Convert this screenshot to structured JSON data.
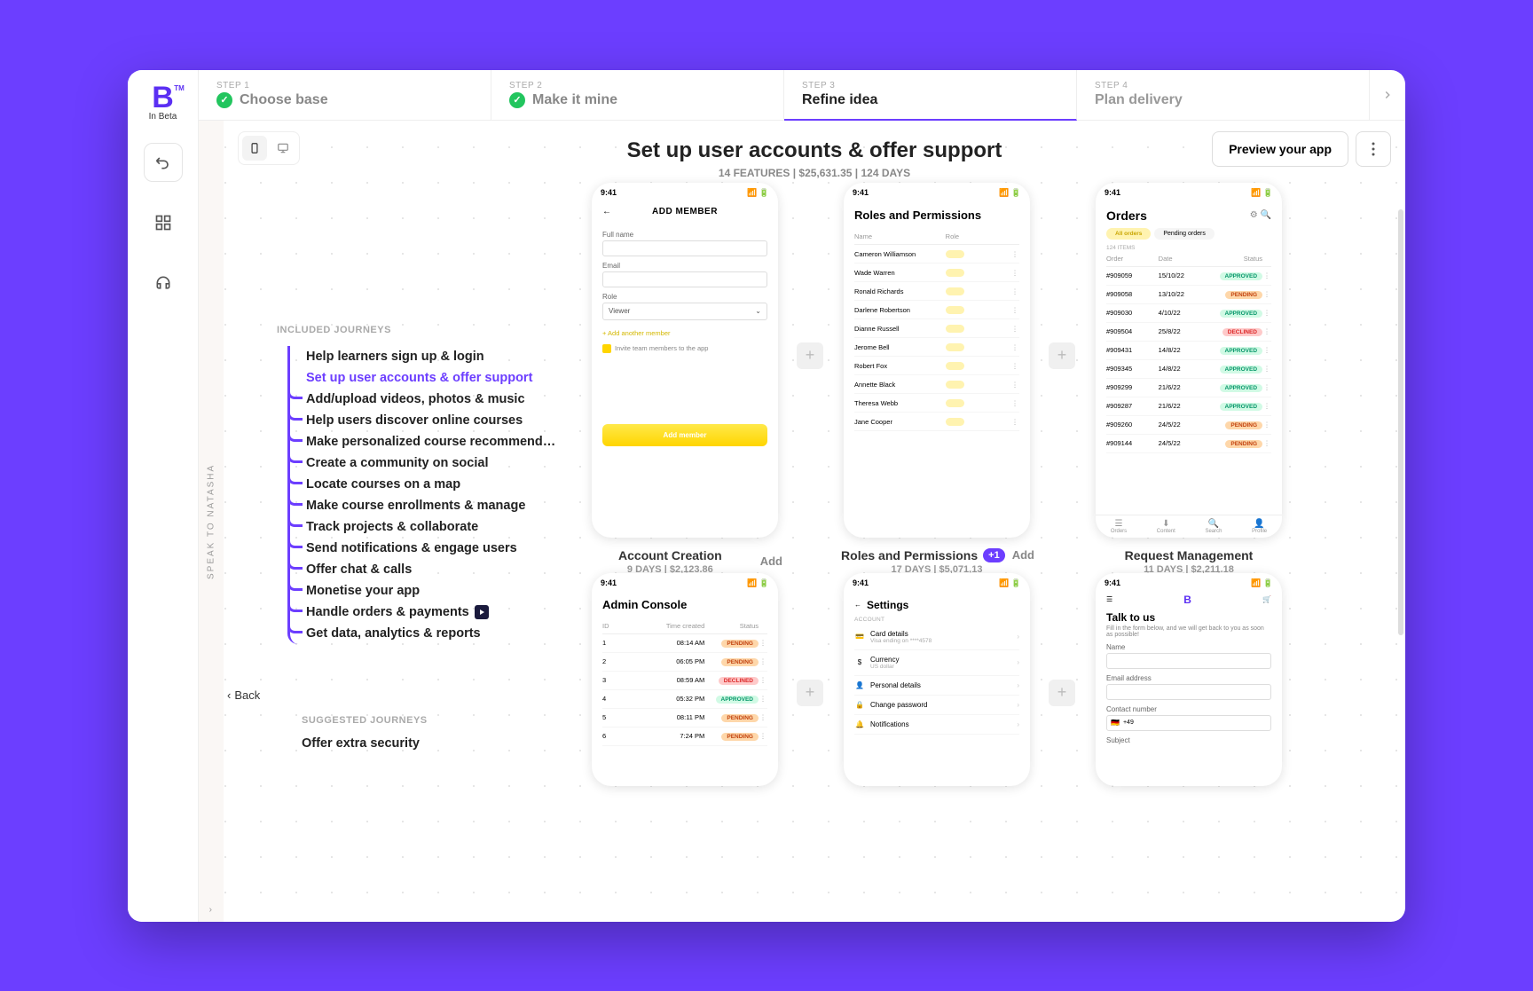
{
  "brand": {
    "logo": "B",
    "tm": "TM",
    "sub": "In Beta"
  },
  "steps": [
    {
      "num": "STEP 1",
      "title": "Choose base",
      "done": true
    },
    {
      "num": "STEP 2",
      "title": "Make it mine",
      "done": true
    },
    {
      "num": "STEP 3",
      "title": "Refine idea",
      "active": true
    },
    {
      "num": "STEP 4",
      "title": "Plan delivery"
    }
  ],
  "header": {
    "title": "Set up user accounts & offer support",
    "features": "14 FEATURES",
    "price": "$25,631.35",
    "days": "124 DAYS"
  },
  "actions": {
    "preview": "Preview your app"
  },
  "speak_label": "SPEAK TO NATASHA",
  "back_label": "Back",
  "journeys": {
    "included_heading": "INCLUDED JOURNEYS",
    "items": [
      "Help learners sign up & login",
      "Set up user accounts & offer support",
      "Add/upload videos, photos & music",
      "Help users discover online courses",
      "Make personalized course recommendations",
      "Create a community on social",
      "Locate courses on a map",
      "Make course enrollments & manage",
      "Track projects & collaborate",
      "Send notifications & engage users",
      "Offer chat & calls",
      "Monetise your app",
      "Handle orders & payments",
      "Get data, analytics & reports"
    ],
    "suggested_heading": "SUGGESTED JOURNEYS",
    "suggested": [
      "Offer extra security"
    ]
  },
  "cards": [
    {
      "title": "Account Creation",
      "meta": "9 DAYS | $2,123.86",
      "add": "Add",
      "mock": {
        "time": "9:41",
        "header": "ADD MEMBER",
        "fields": {
          "fullname": "Full name",
          "email": "Email",
          "role": "Role",
          "role_value": "Viewer"
        },
        "link": "+ Add another member",
        "checkbox": "Invite team members to the app",
        "button": "Add member"
      }
    },
    {
      "title": "Roles and Permissions",
      "plus": "+1",
      "meta": "17 DAYS | $5,071.13",
      "add": "Add",
      "mock": {
        "time": "9:41",
        "header": "Roles and Permissions",
        "cols": [
          "Name",
          "Role"
        ],
        "rows": [
          "Cameron Williamson",
          "Wade Warren",
          "Ronald Richards",
          "Darlene Robertson",
          "Dianne Russell",
          "Jerome Bell",
          "Robert Fox",
          "Annette Black",
          "Theresa Webb",
          "Jane Cooper"
        ]
      }
    },
    {
      "title": "Request Management",
      "meta": "11 DAYS | $2,211.18",
      "mock": {
        "time": "9:41",
        "header": "Orders",
        "tabs": [
          "All orders",
          "Pending orders"
        ],
        "count": "124 ITEMS",
        "cols": [
          "Order",
          "Date",
          "Status"
        ],
        "rows": [
          [
            "#909059",
            "15/10/22",
            "APPROVED"
          ],
          [
            "#909058",
            "13/10/22",
            "PENDING"
          ],
          [
            "#909030",
            "4/10/22",
            "APPROVED"
          ],
          [
            "#909504",
            "25/8/22",
            "DECLINED"
          ],
          [
            "#909431",
            "14/8/22",
            "APPROVED"
          ],
          [
            "#909345",
            "14/8/22",
            "APPROVED"
          ],
          [
            "#909299",
            "21/6/22",
            "APPROVED"
          ],
          [
            "#909287",
            "21/6/22",
            "APPROVED"
          ],
          [
            "#909260",
            "24/5/22",
            "PENDING"
          ],
          [
            "#909144",
            "24/5/22",
            "PENDING"
          ]
        ],
        "nav": [
          "Orders",
          "Content",
          "Search",
          "Profile"
        ]
      }
    }
  ],
  "cards2": [
    {
      "mock": {
        "time": "9:41",
        "header": "Admin Console",
        "cols": [
          "ID",
          "Time created",
          "Status"
        ],
        "rows": [
          [
            "1",
            "08:14 AM",
            "PENDING"
          ],
          [
            "2",
            "06:05 PM",
            "PENDING"
          ],
          [
            "3",
            "08:59 AM",
            "DECLINED"
          ],
          [
            "4",
            "05:32 PM",
            "APPROVED"
          ],
          [
            "5",
            "08:11 PM",
            "PENDING"
          ],
          [
            "6",
            "7:24 PM",
            "PENDING"
          ]
        ]
      }
    },
    {
      "mock": {
        "time": "9:41",
        "header": "Settings",
        "section": "ACCOUNT",
        "items": [
          {
            "icon": "card",
            "label": "Card details",
            "sub": "Visa ending on ****4578"
          },
          {
            "icon": "dollar",
            "label": "Currency",
            "sub": "US dollar"
          },
          {
            "icon": "user",
            "label": "Personal details"
          },
          {
            "icon": "lock",
            "label": "Change password"
          },
          {
            "icon": "bell",
            "label": "Notifications"
          }
        ]
      }
    },
    {
      "mock": {
        "time": "9:41",
        "header": "Talk to us",
        "sub": "Fill in the form below, and we will get back to you as soon as possible!",
        "fields": [
          "Name",
          "Email address",
          "Contact number",
          "Subject"
        ],
        "phone_prefix": "+49"
      }
    }
  ]
}
